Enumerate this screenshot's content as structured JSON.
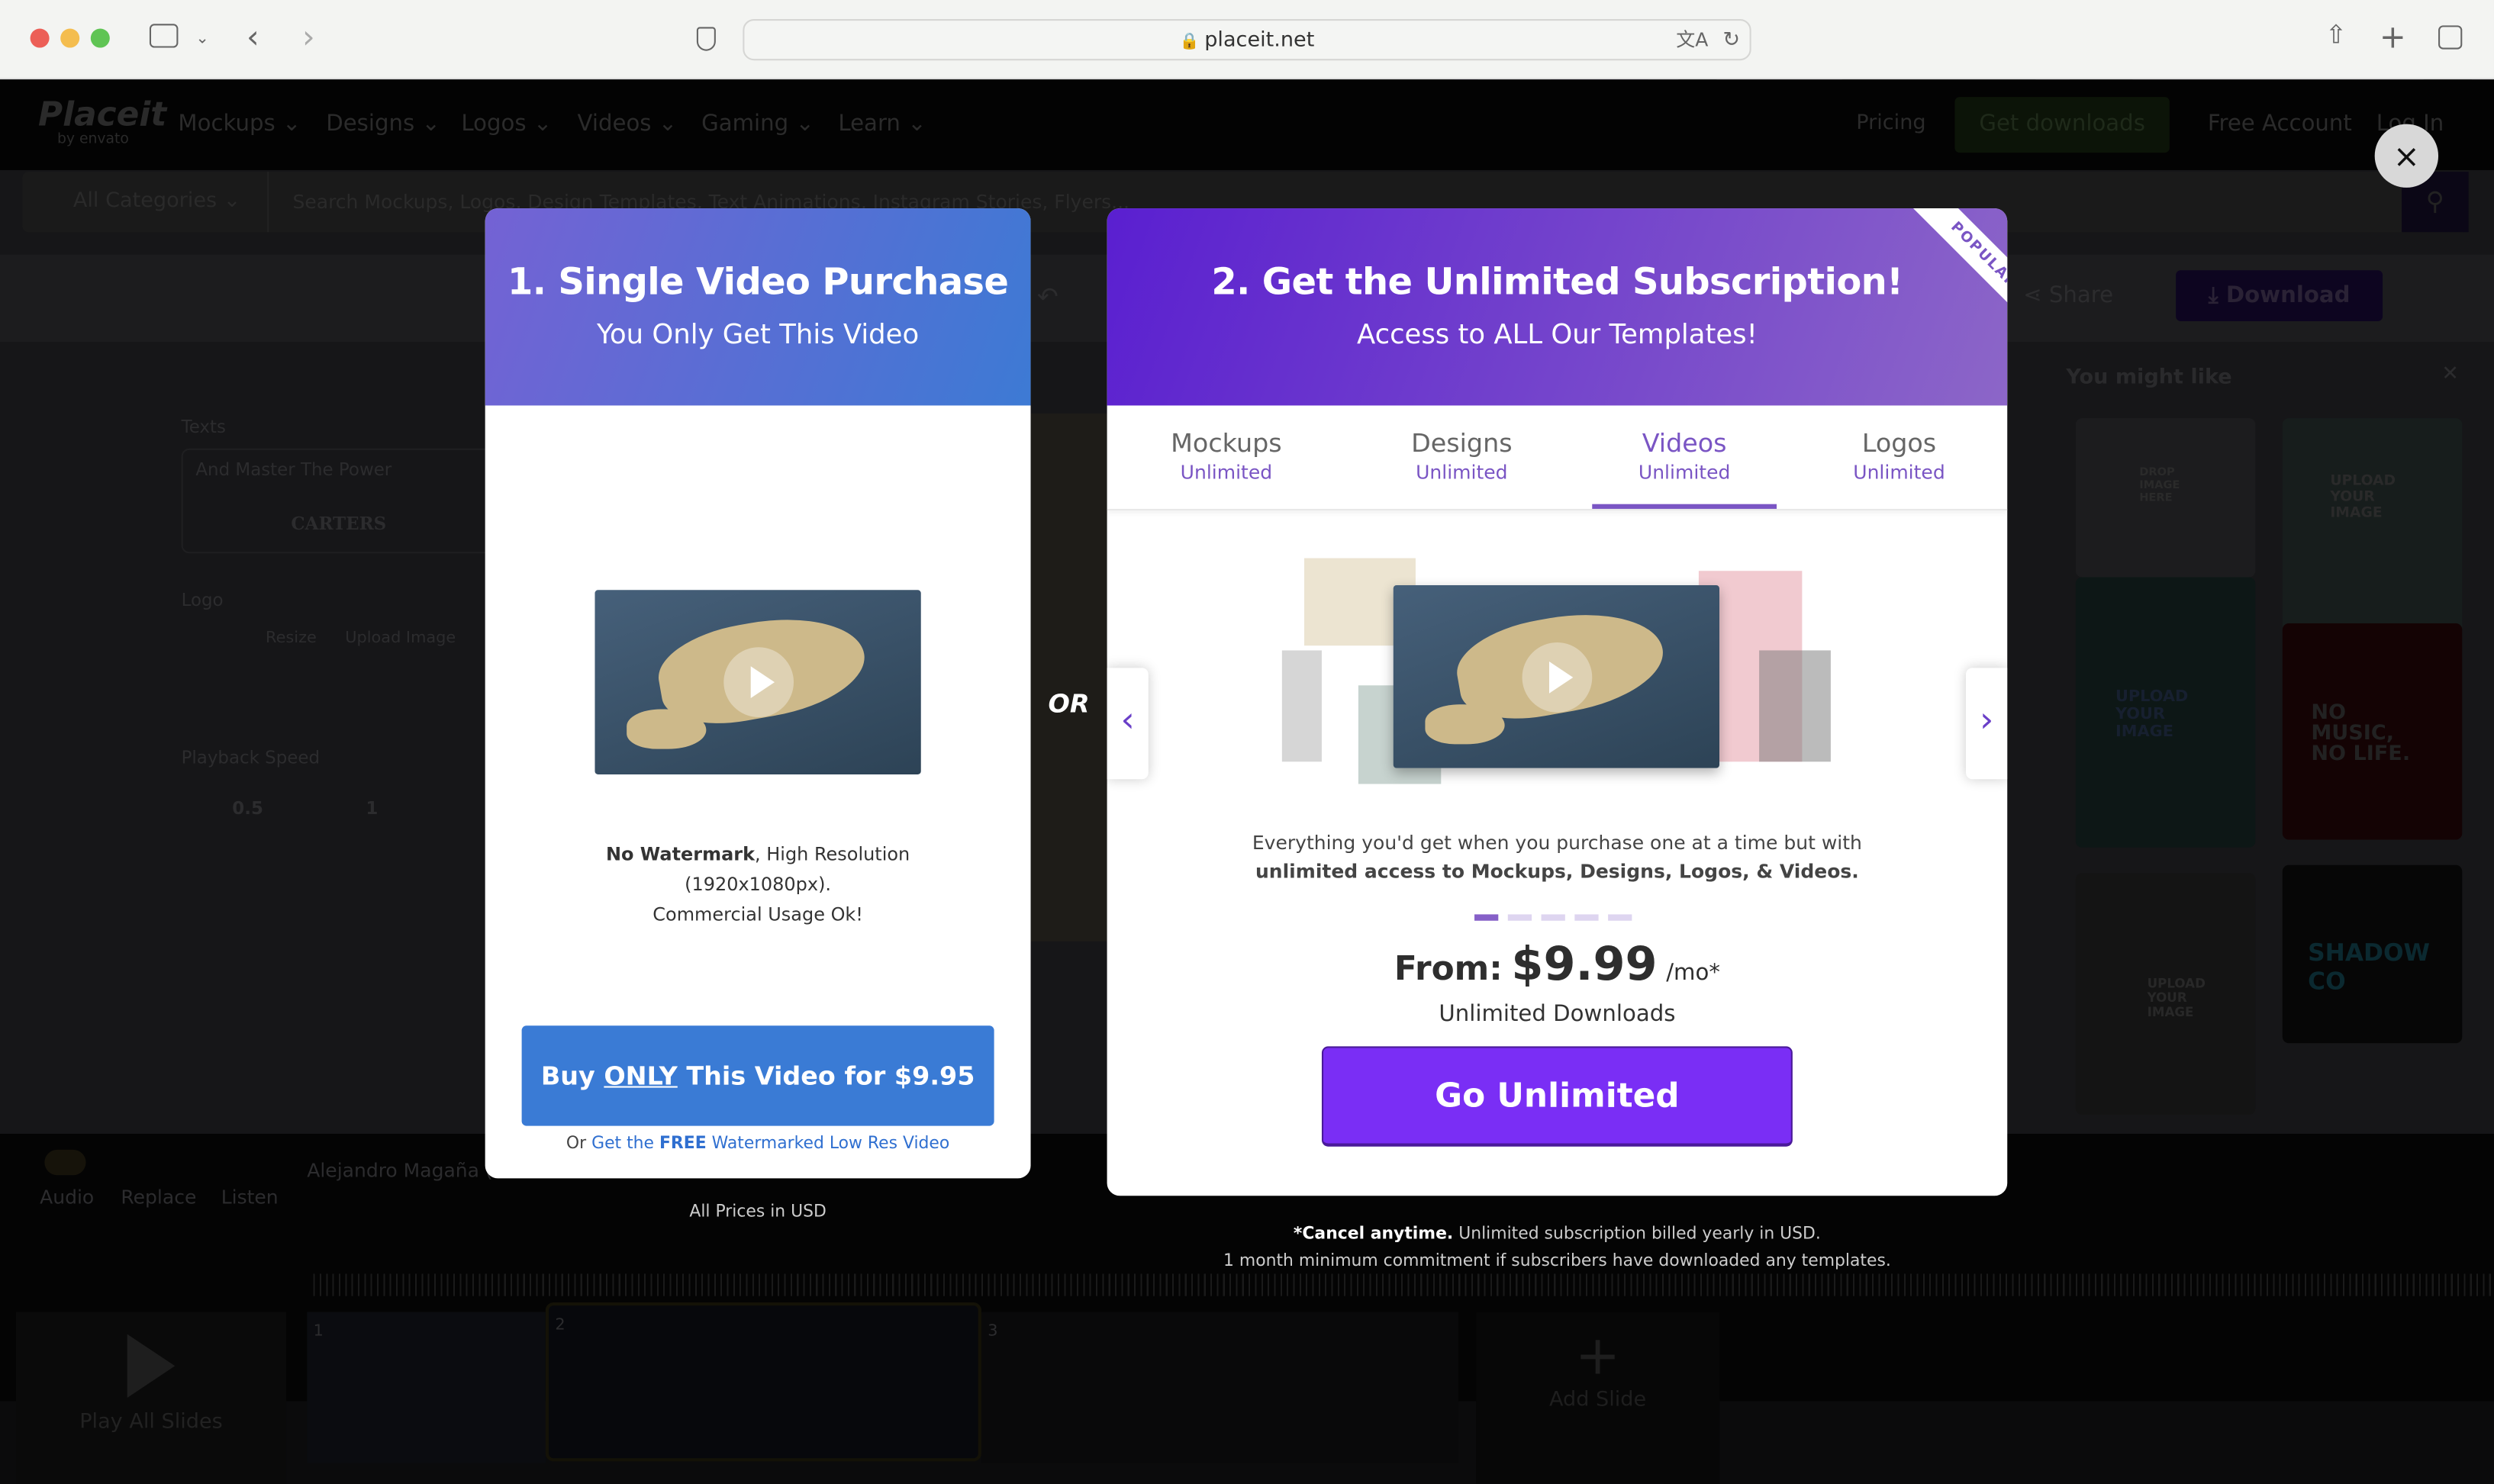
{
  "browser": {
    "url": "placeit.net",
    "icons": [
      "close-window",
      "minimize",
      "maximize",
      "sidebar-icon",
      "chevron-down-icon",
      "back-icon",
      "forward-icon",
      "shield-icon",
      "lock-icon",
      "translate-icon",
      "reload-icon",
      "share-icon",
      "new-tab-icon",
      "tabs-icon"
    ]
  },
  "nav": {
    "logo": "Placeit",
    "logo_sub": "by envato",
    "items": [
      "Mockups",
      "Designs",
      "Logos",
      "Videos",
      "Gaming",
      "Learn"
    ],
    "pricing": "Pricing",
    "get_downloads": "Get downloads",
    "free_account": "Free Account",
    "login": "Log In"
  },
  "search": {
    "category": "All Categories",
    "placeholder": "Search Mockups, Logos, Design Templates, Text Animations, Instagram Stories, Flyers..."
  },
  "toolbar": {
    "share": "Share",
    "download": "Download"
  },
  "editor": {
    "texts_label": "Texts",
    "text_value": "And Master The Power",
    "text_value2": "CARTERS",
    "logo_label": "Logo",
    "resize": "Resize",
    "upload_image": "Upload Image",
    "playback_label": "Playback Speed",
    "speeds": [
      "0.5",
      "1"
    ]
  },
  "sidebar": {
    "title": "You might like",
    "thumbs": [
      "DROP IMAGE HERE",
      "UPLOAD YOUR IMAGE",
      "UPLOAD YOUR IMAGE",
      "NO MUSIC, NO LIFE.",
      "UPLOAD YOUR IMAGE",
      "SHADOW CO"
    ]
  },
  "audio": {
    "audio": "Audio",
    "replace": "Replace",
    "listen": "Listen",
    "track": "Alejandro Magaña (",
    "play_all": "Play All Slides",
    "slides": [
      "1",
      "2",
      "3"
    ],
    "add_slide": "Add Slide"
  },
  "modal": {
    "or": "OR",
    "left": {
      "title": "1. Single Video Purchase",
      "subtitle": "You Only Get This Video",
      "feature_bold": "No Watermark",
      "feature_rest": ", High Resolution",
      "resolution": "(1920x1080px).",
      "commercial": "Commercial Usage Ok!",
      "buy_pre": "Buy ",
      "buy_only": "ONLY",
      "buy_post": " This Video for $9.95",
      "free_pre": "Or ",
      "free_link_pre": "Get the ",
      "free_link_bold": "FREE",
      "free_link_post": " Watermarked Low Res Video",
      "prices_note": "All Prices in USD"
    },
    "right": {
      "title": "2. Get the Unlimited Subscription!",
      "subtitle": "Access to ALL Our Templates!",
      "ribbon": "POPULAR",
      "tabs": [
        {
          "label": "Mockups",
          "sub": "Unlimited"
        },
        {
          "label": "Designs",
          "sub": "Unlimited"
        },
        {
          "label": "Videos",
          "sub": "Unlimited",
          "active": true
        },
        {
          "label": "Logos",
          "sub": "Unlimited"
        }
      ],
      "desc1": "Everything you'd get when you purchase one at a time but with",
      "desc2": "unlimited access to Mockups, Designs, Logos, & Videos.",
      "carousel_pages": 5,
      "carousel_active": 1,
      "price_from": "From:",
      "price": "$9.99",
      "price_unit": "/mo*",
      "unlimited_downloads": "Unlimited Downloads",
      "cta": "Go Unlimited",
      "cancel_bold": "*Cancel anytime.",
      "cancel_rest": " Unlimited subscription billed yearly in USD.",
      "commitment": "1 month minimum commitment if subscribers have downloaded any templates."
    },
    "close": "×"
  },
  "colors": {
    "accent": "#7b2ff7",
    "left_header": "#3d7ad4",
    "right_header": "#5a1fd0",
    "buy_button": "#3a7bd5",
    "tab_active": "#7a55c4"
  }
}
